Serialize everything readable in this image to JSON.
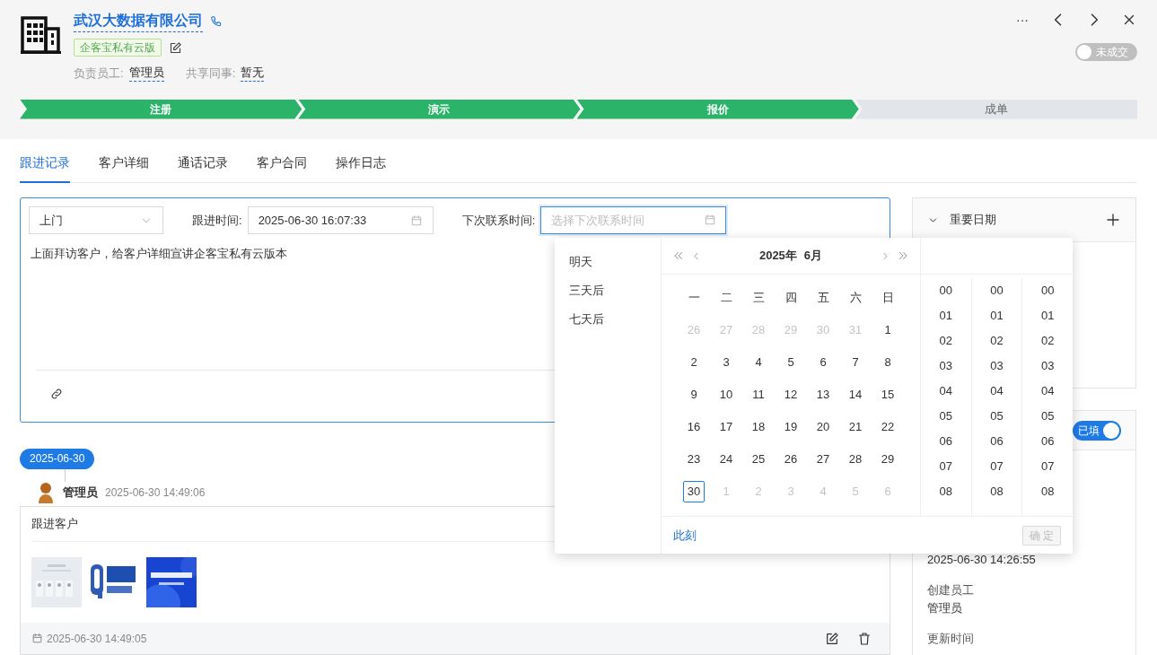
{
  "header": {
    "company": "武汉大数据有限公司",
    "tag": "企客宝私有云版",
    "owner_label": "负责员工:",
    "owner": "管理员",
    "share_label": "共享同事:",
    "share": "暂无",
    "more": "···",
    "deal_toggle": {
      "label": "未成交",
      "on": false
    }
  },
  "stages": [
    {
      "label": "注册",
      "done": true
    },
    {
      "label": "演示",
      "done": true
    },
    {
      "label": "报价",
      "done": true
    },
    {
      "label": "成单",
      "done": false
    }
  ],
  "tabs": [
    {
      "label": "跟进记录",
      "selected": true
    },
    {
      "label": "客户详细",
      "selected": false
    },
    {
      "label": "通话记录",
      "selected": false
    },
    {
      "label": "客户合同",
      "selected": false
    },
    {
      "label": "操作日志",
      "selected": false
    }
  ],
  "form": {
    "type": "上门",
    "follow_label": "跟进时间:",
    "follow_value": "2025-06-30 16:07:33",
    "next_label": "下次联系时间:",
    "next_placeholder": "选择下次联系时间",
    "content": "上面拜访客户，给客户详细宣讲企客宝私有云版本"
  },
  "date_picker": {
    "presets": [
      "明天",
      "三天后",
      "七天后"
    ],
    "year": "2025年",
    "month": "6月",
    "weekdays": [
      "一",
      "二",
      "三",
      "四",
      "五",
      "六",
      "日"
    ],
    "days": [
      {
        "text": "26",
        "outside": true,
        "selected": false
      },
      {
        "text": "27",
        "outside": true,
        "selected": false
      },
      {
        "text": "28",
        "outside": true,
        "selected": false
      },
      {
        "text": "29",
        "outside": true,
        "selected": false
      },
      {
        "text": "30",
        "outside": true,
        "selected": false
      },
      {
        "text": "31",
        "outside": true,
        "selected": false
      },
      {
        "text": "1",
        "outside": false,
        "selected": false
      },
      {
        "text": "2",
        "outside": false,
        "selected": false
      },
      {
        "text": "3",
        "outside": false,
        "selected": false
      },
      {
        "text": "4",
        "outside": false,
        "selected": false
      },
      {
        "text": "5",
        "outside": false,
        "selected": false
      },
      {
        "text": "6",
        "outside": false,
        "selected": false
      },
      {
        "text": "7",
        "outside": false,
        "selected": false
      },
      {
        "text": "8",
        "outside": false,
        "selected": false
      },
      {
        "text": "9",
        "outside": false,
        "selected": false
      },
      {
        "text": "10",
        "outside": false,
        "selected": false
      },
      {
        "text": "11",
        "outside": false,
        "selected": false
      },
      {
        "text": "12",
        "outside": false,
        "selected": false
      },
      {
        "text": "13",
        "outside": false,
        "selected": false
      },
      {
        "text": "14",
        "outside": false,
        "selected": false
      },
      {
        "text": "15",
        "outside": false,
        "selected": false
      },
      {
        "text": "16",
        "outside": false,
        "selected": false
      },
      {
        "text": "17",
        "outside": false,
        "selected": false
      },
      {
        "text": "18",
        "outside": false,
        "selected": false
      },
      {
        "text": "19",
        "outside": false,
        "selected": false
      },
      {
        "text": "20",
        "outside": false,
        "selected": false
      },
      {
        "text": "21",
        "outside": false,
        "selected": false
      },
      {
        "text": "22",
        "outside": false,
        "selected": false
      },
      {
        "text": "23",
        "outside": false,
        "selected": false
      },
      {
        "text": "24",
        "outside": false,
        "selected": false
      },
      {
        "text": "25",
        "outside": false,
        "selected": false
      },
      {
        "text": "26",
        "outside": false,
        "selected": false
      },
      {
        "text": "27",
        "outside": false,
        "selected": false
      },
      {
        "text": "28",
        "outside": false,
        "selected": false
      },
      {
        "text": "29",
        "outside": false,
        "selected": false
      },
      {
        "text": "30",
        "outside": false,
        "selected": true
      },
      {
        "text": "1",
        "outside": true,
        "selected": false
      },
      {
        "text": "2",
        "outside": true,
        "selected": false
      },
      {
        "text": "3",
        "outside": true,
        "selected": false
      },
      {
        "text": "4",
        "outside": true,
        "selected": false
      },
      {
        "text": "5",
        "outside": true,
        "selected": false
      },
      {
        "text": "6",
        "outside": true,
        "selected": false
      }
    ],
    "hours": [
      "00",
      "01",
      "02",
      "03",
      "04",
      "05",
      "06",
      "07",
      "08"
    ],
    "minutes": [
      "00",
      "01",
      "02",
      "03",
      "04",
      "05",
      "06",
      "07",
      "08"
    ],
    "seconds": [
      "00",
      "01",
      "02",
      "03",
      "04",
      "05",
      "06",
      "07",
      "08"
    ],
    "now": "此刻",
    "ok": {
      "label": "确 定",
      "disabled": true
    }
  },
  "timeline": {
    "date": "2025-06-30",
    "user": "管理员",
    "time": "2025-06-30 14:49:06",
    "title": "跟进客户",
    "footer_time": "2025-06-30 14:49:05"
  },
  "side": {
    "important_dates": {
      "title": "重要日期",
      "expanded": true
    },
    "details": {
      "toggle": {
        "label": "已填",
        "on": true
      },
      "fields": [
        {
          "value": "2025-06-30 14:26:55"
        },
        {
          "label": "创建员工",
          "value": "管理员"
        },
        {
          "label": "更新时间"
        }
      ]
    }
  }
}
